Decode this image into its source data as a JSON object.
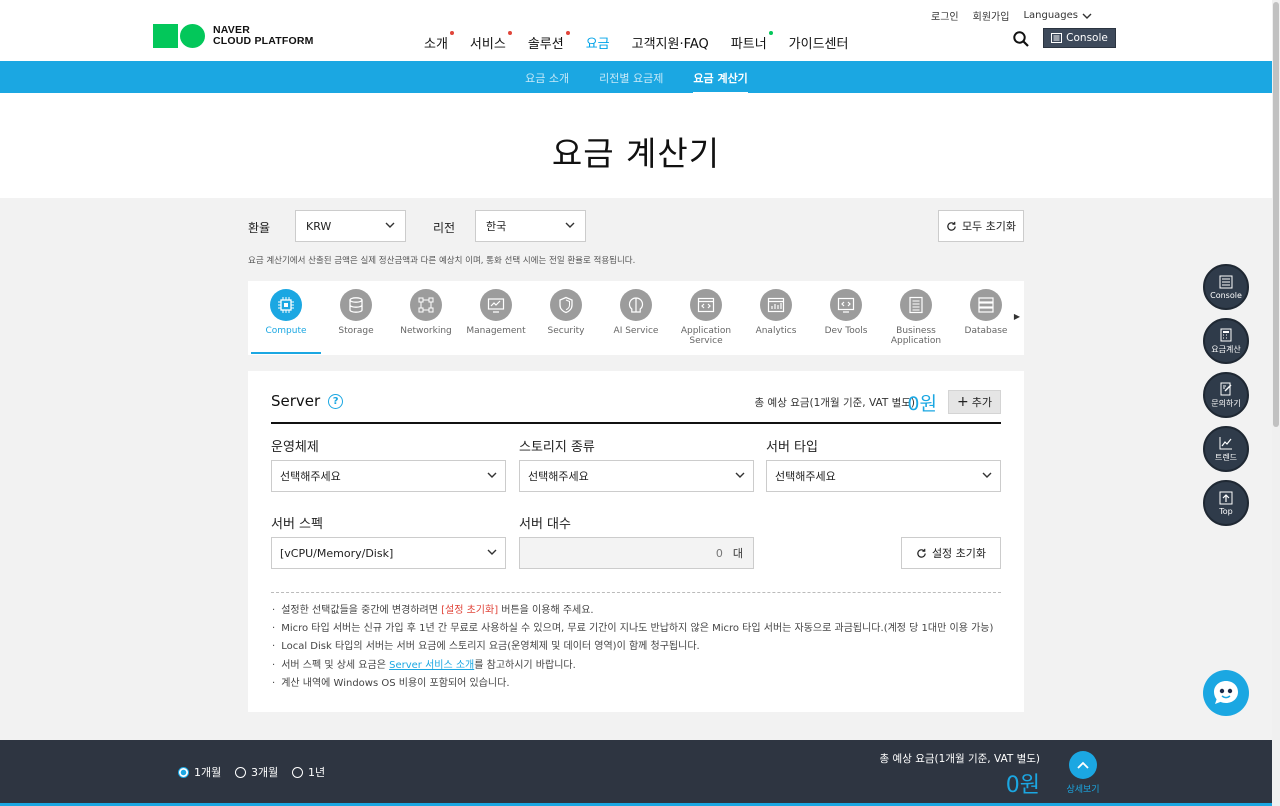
{
  "header": {
    "logo_line1": "NAVER",
    "logo_line2": "CLOUD PLATFORM",
    "util": {
      "login": "로그인",
      "signup": "회원가입",
      "languages": "Languages"
    },
    "nav": [
      {
        "label": "소개",
        "dot_color": "#e0453a"
      },
      {
        "label": "서비스",
        "dot_color": "#e0453a"
      },
      {
        "label": "솔루션",
        "dot_color": "#e0453a"
      },
      {
        "label": "요금",
        "dot_color": ""
      },
      {
        "label": "고객지원·FAQ",
        "dot_color": ""
      },
      {
        "label": "파트너",
        "dot_color": "#03c75a"
      },
      {
        "label": "가이드센터",
        "dot_color": ""
      }
    ],
    "active_nav": "요금",
    "console_label": "Console"
  },
  "subnav": [
    {
      "label": "요금 소개"
    },
    {
      "label": "리전별 요금제"
    },
    {
      "label": "요금 계산기"
    }
  ],
  "page_title": "요금 계산기",
  "controls": {
    "currency_label": "환율",
    "currency_value": "KRW",
    "region_label": "리전",
    "region_value": "한국",
    "reset_all": "모두 초기화",
    "notice": "요금 계산기에서 산출된 금액은 실제 정산금액과 다른 예상치 이며, 통화 선택 시에는 전일 환율로 적용됩니다."
  },
  "categories": [
    {
      "label": "Compute",
      "icon": "cpu-icon"
    },
    {
      "label": "Storage",
      "icon": "database-disk-icon"
    },
    {
      "label": "Networking",
      "icon": "network-icon"
    },
    {
      "label": "Management",
      "icon": "monitor-chart-icon"
    },
    {
      "label": "Security",
      "icon": "shield-icon"
    },
    {
      "label": "AI Service",
      "icon": "brain-icon"
    },
    {
      "label": "Application Service",
      "icon": "code-window-icon"
    },
    {
      "label": "Analytics",
      "icon": "analytics-icon"
    },
    {
      "label": "Dev Tools",
      "icon": "dev-tools-icon"
    },
    {
      "label": "Business Application",
      "icon": "document-icon"
    },
    {
      "label": "Database",
      "icon": "server-stack-icon"
    }
  ],
  "server_panel": {
    "title": "Server",
    "total_label": "총 예상 요금(1개월 기준, VAT 별도)",
    "total_value": "0원",
    "add_label": "추가",
    "os_label": "운영체제",
    "os_value": "선택해주세요",
    "storage_label": "스토리지 종류",
    "storage_value": "선택해주세요",
    "type_label": "서버 타입",
    "type_value": "선택해주세요",
    "spec_label": "서버 스펙",
    "spec_value": "[vCPU/Memory/Disk]",
    "count_label": "서버 대수",
    "count_value": "0",
    "count_unit": "대",
    "reset_label": "설정 초기화",
    "notes": {
      "n1_pre": "설정한 선택값들을 중간에 변경하려면 ",
      "n1_red": "[설정 초기화]",
      "n1_post": " 버튼을 이용해 주세요.",
      "n2": "Micro 타입 서버는 신규 가입 후 1년 간 무료로 사용하실 수 있으며, 무료 기간이 지나도 반납하지 않은 Micro 타입 서버는 자동으로 과금됩니다.(계정 당 1대만 이용 가능)",
      "n3": "Local Disk 타입의 서버는 서버 요금에 스토리지 요금(운영체제 및 데이터 영역)이 함께 청구됩니다.",
      "n4_pre": "서버 스펙 및 상세 요금은 ",
      "n4_link": "Server 서비스 소개",
      "n4_post": "를 참고하시기 바랍니다.",
      "n5": "계산 내역에 Windows OS 비용이 포함되어 있습니다."
    }
  },
  "fabs": [
    {
      "label": "Console",
      "icon": "console-icon"
    },
    {
      "label": "요금계산",
      "icon": "calculator-icon"
    },
    {
      "label": "문의하기",
      "icon": "inquiry-icon"
    },
    {
      "label": "트렌드",
      "icon": "trend-chart-icon"
    },
    {
      "label": "Top",
      "icon": "arrow-up-icon"
    }
  ],
  "bottom_bar": {
    "periods": [
      {
        "label": "1개월",
        "selected": true
      },
      {
        "label": "3개월",
        "selected": false
      },
      {
        "label": "1년",
        "selected": false
      }
    ],
    "total_label": "총 예상 요금(1개월 기준, VAT 별도)",
    "total_value": "0원",
    "detail_label": "상세보기"
  },
  "colors": {
    "accent": "#1ba7e2",
    "brand_green": "#03c75a",
    "dark": "#2e3541",
    "red": "#e0453a"
  }
}
